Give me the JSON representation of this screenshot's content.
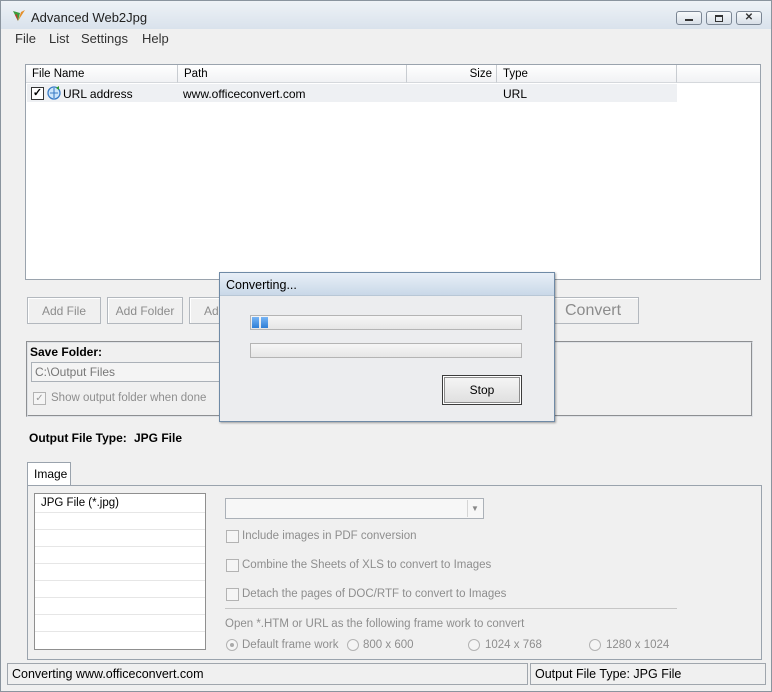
{
  "window": {
    "title": "Advanced Web2Jpg"
  },
  "menu": [
    "File",
    "List",
    "Settings",
    "Help"
  ],
  "file_list": {
    "columns": [
      "File Name",
      "Path",
      "Size",
      "Type"
    ],
    "rows": [
      {
        "checked": true,
        "name": "URL address",
        "path": "www.officeconvert.com",
        "size": "",
        "type": "URL"
      }
    ]
  },
  "buttons": {
    "add_file": "Add File",
    "add_folder": "Add Folder",
    "add_partial": "Ad",
    "convert": "Convert"
  },
  "save_folder": {
    "label": "Save Folder:",
    "path": "C:\\Output Files",
    "show_output_label": "Show output folder when done",
    "show_output_checked": true
  },
  "output_type": {
    "label": "Output File Type:",
    "value": "JPG File"
  },
  "tabs": [
    "Image"
  ],
  "format_list": [
    "JPG File  (*.jpg)"
  ],
  "format_combo_value": "",
  "options": {
    "include_pdf": "Include images in PDF conversion",
    "combine_xls": "Combine the Sheets of XLS to convert to Images",
    "detach_doc": "Detach the pages of DOC/RTF to convert to Images",
    "frame_work_label": "Open *.HTM or URL as the following frame work to convert",
    "frame_options": [
      "Default frame work",
      "800 x 600",
      "1024 x 768",
      "1280 x 1024"
    ],
    "selected_frame": "Default frame work"
  },
  "status": {
    "left": "Converting  www.officeconvert.com",
    "right": "Output File Type:  JPG File"
  },
  "dialog": {
    "title": "Converting...",
    "progress_blocks": 2,
    "progress_fraction": 0.07,
    "progress2_fraction": 0,
    "stop_label": "Stop"
  }
}
